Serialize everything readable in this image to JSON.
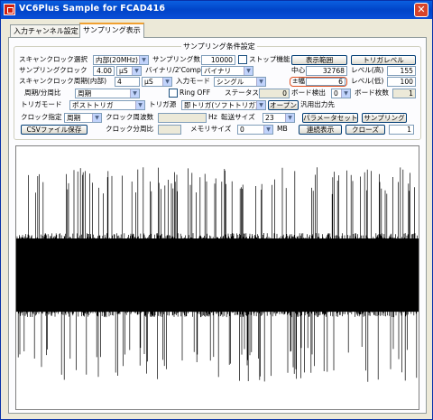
{
  "window": {
    "title": "VC6Plus Sample for FCAD416",
    "close": "✕"
  },
  "tabs": [
    "入力チャンネル設定",
    "サンプリング表示"
  ],
  "group": {
    "title": "サンプリング条件設定"
  },
  "form": {
    "scan_clock_label": "スキャンクロック選択",
    "scan_clock_value": "内部(20MHz)",
    "sampling_count_label": "サンプリング数",
    "sampling_count_value": "10000",
    "stop_function_label": "ストップ機能",
    "display_range_label": "表示範囲",
    "trigger_level_label": "トリガレベル",
    "sampling_clock_label": "サンプリングクロック",
    "sampling_clock_value": "4.00",
    "sampling_clock_unit": "μS",
    "binary_2comp_label": "バイナリ/2'Comp",
    "binary_2comp_value": "バイナリ",
    "center_label": "中心",
    "center_value": "32768",
    "level_high_label": "レベル(高)",
    "level_high_value": "155",
    "scan_period_label": "スキャンクロック周期(内部)",
    "scan_period_value": "4",
    "scan_period_unit": "μS",
    "input_mode_label": "入力モード",
    "input_mode_value": "シングル",
    "amplitude_label": "±幅",
    "amplitude_value": "6",
    "level_low_label": "レベル(低)",
    "level_low_value": "100",
    "cycle_label": "周期/分周比",
    "cycle_value": "周期",
    "ring_off_label": "Ring OFF",
    "status_label": "ステータス",
    "status_value": "0",
    "board_detect_label": "ボード検出",
    "board_detect_value": "0",
    "board_count_label": "ボード枚数",
    "board_count_value": "1",
    "trigger_mode_label": "トリガモード",
    "trigger_mode_value": "ポストトリガ",
    "trigger_source_label": "トリガ源",
    "trigger_source_value": "即トリガ(ソフトトリガ)",
    "open_button": "オープン",
    "general_output_label": "汎用出力先",
    "clock_spec_label": "クロック指定",
    "clock_spec_value": "周期",
    "clock_freq_label": "クロック周波数",
    "clock_freq_unit": "Hz",
    "transfer_size_label": "転送サイズ",
    "transfer_size_value": "23",
    "param_set_button": "パラメータセット",
    "sampling_button": "サンプリング",
    "csv_save_button": "CSVファイル保存",
    "clock_div_label": "クロック分周比",
    "memory_size_label": "メモリサイズ",
    "memory_size_value": "0",
    "mb_label": "MB",
    "continuous_button": "連続表示",
    "close_button": "クローズ",
    "last_value": "1"
  },
  "chart_data": {
    "type": "line",
    "title": "",
    "xlabel": "",
    "ylabel": "",
    "series_color": "#000000",
    "background": "#ffffff",
    "dense_band_fraction": [
      0.33,
      0.65
    ],
    "sparse_band_fraction": [
      0.08,
      0.9
    ]
  }
}
